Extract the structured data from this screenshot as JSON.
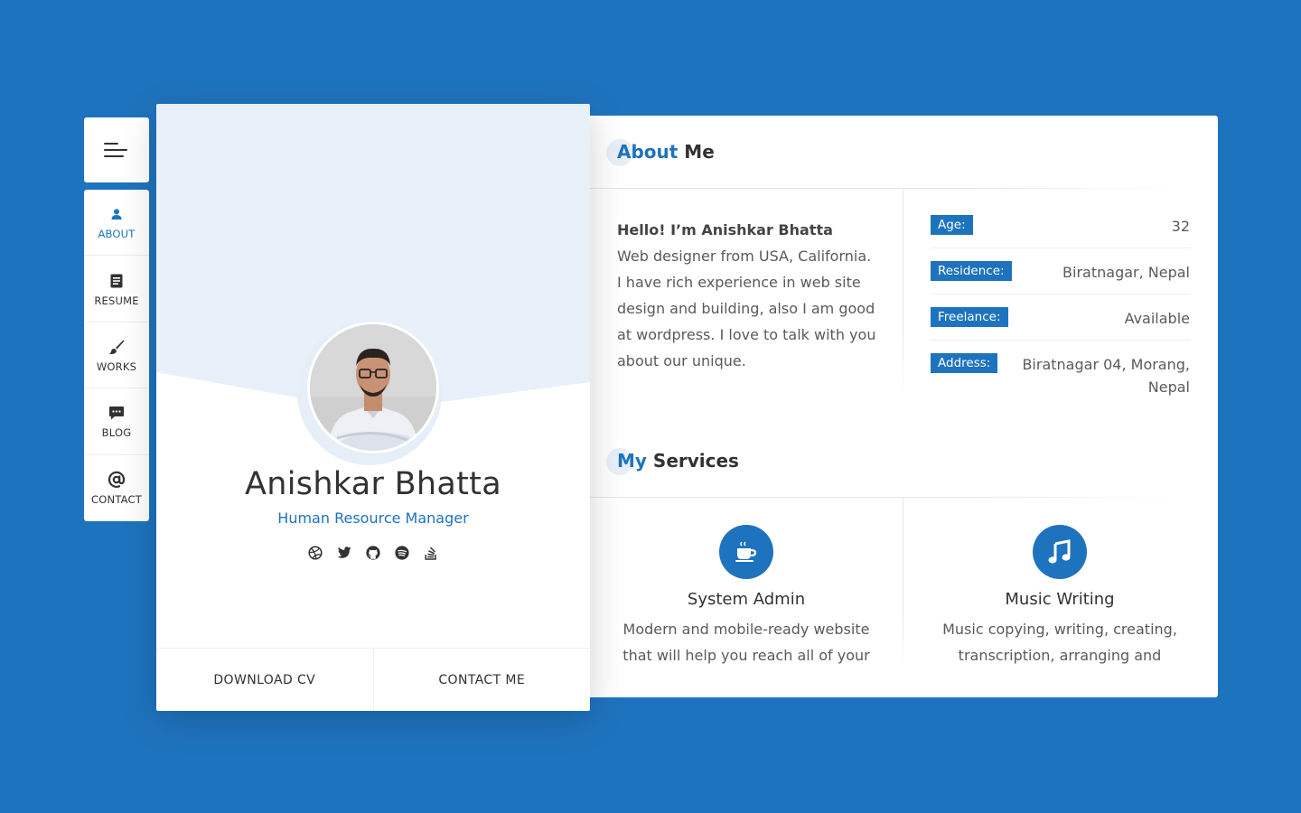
{
  "nav": {
    "items": [
      {
        "label": "ABOUT",
        "icon": "user-icon",
        "active": true
      },
      {
        "label": "RESUME",
        "icon": "document-icon",
        "active": false
      },
      {
        "label": "WORKS",
        "icon": "brush-icon",
        "active": false
      },
      {
        "label": "BLOG",
        "icon": "chat-icon",
        "active": false
      },
      {
        "label": "CONTACT",
        "icon": "at-icon",
        "active": false
      }
    ]
  },
  "profile": {
    "name": "Anishkar Bhatta",
    "role": "Human Resource Manager",
    "socials": [
      "dribbble-icon",
      "twitter-icon",
      "github-icon",
      "spotify-icon",
      "stackoverflow-icon"
    ],
    "download_cv": "DOWNLOAD CV",
    "contact_me": "CONTACT ME"
  },
  "about": {
    "title_accent": "About",
    "title_rest": " Me",
    "hello": "Hello! I’m Anishkar Bhatta",
    "bio": "Web designer from USA, California. I have rich experience in web site design and building, also I am good at wordpress. I love to talk with you about our unique.",
    "info": [
      {
        "key": "Age:",
        "value": "32"
      },
      {
        "key": "Residence:",
        "value": "Biratnagar, Nepal"
      },
      {
        "key": "Freelance:",
        "value": "Available"
      },
      {
        "key": "Address:",
        "value": "Biratnagar 04, Morang, Nepal"
      }
    ]
  },
  "services": {
    "title_accent": "My",
    "title_rest": " Services",
    "items": [
      {
        "title": "System Admin",
        "desc": "Modern and mobile-ready website that will help you reach all of your",
        "icon": "coffee-icon"
      },
      {
        "title": "Music Writing",
        "desc": "Music copying, writing, creating, transcription, arranging and",
        "icon": "music-note-icon"
      }
    ]
  },
  "colors": {
    "accent": "#1e73be",
    "background": "#1e73be"
  }
}
